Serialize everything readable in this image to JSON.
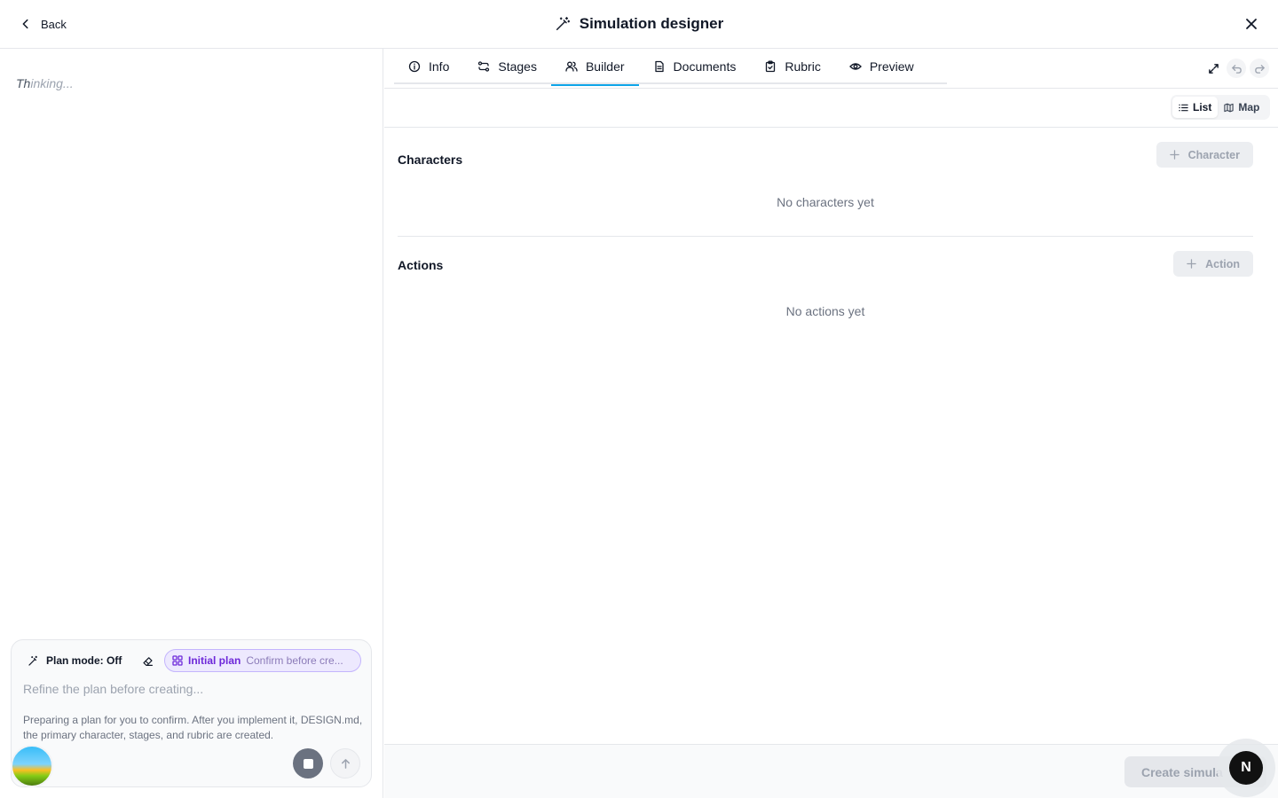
{
  "header": {
    "back_label": "Back",
    "title": "Simulation designer"
  },
  "chat": {
    "thinking_lead": "Th",
    "thinking_rest": "inking..."
  },
  "composer": {
    "plan_mode_label": "Plan mode: Off",
    "chip_label": "Initial plan",
    "chip_subtitle": "Confirm before cre...",
    "input_placeholder": "Refine the plan before creating...",
    "note": "Preparing a plan for you to confirm. After you implement it, DESIGN.md, the primary character, stages, and rubric are created."
  },
  "tabs": [
    {
      "label": "Info",
      "icon": "info-icon"
    },
    {
      "label": "Stages",
      "icon": "stages-icon"
    },
    {
      "label": "Builder",
      "icon": "users-icon",
      "active": true
    },
    {
      "label": "Documents",
      "icon": "document-icon"
    },
    {
      "label": "Rubric",
      "icon": "clipboard-icon"
    },
    {
      "label": "Preview",
      "icon": "eye-icon"
    }
  ],
  "view_toggle": {
    "list_label": "List",
    "map_label": "Map",
    "selected": "List"
  },
  "characters": {
    "title": "Characters",
    "add_label": "Character",
    "empty": "No characters yet"
  },
  "actions": {
    "title": "Actions",
    "add_label": "Action",
    "empty": "No actions yet"
  },
  "footer": {
    "create_label": "Create simula"
  },
  "badge": {
    "letter": "N"
  },
  "colors": {
    "accent": "#0ea5e9",
    "chip_bg": "#ede9fe",
    "chip_text": "#6d28d9"
  }
}
